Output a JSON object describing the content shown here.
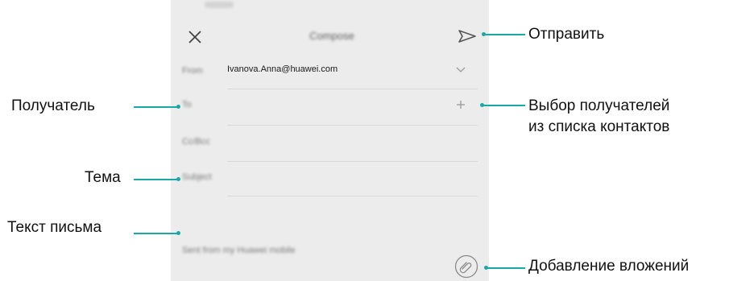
{
  "email": {
    "title": "Compose",
    "from_label": "From",
    "from_value": "Ivanova.Anna@huawei.com",
    "to_label": "To",
    "cc_bcc_label": "Cc/Bcc",
    "subject_label": "Subject",
    "body_placeholder": "Sent from my Huawei mobile"
  },
  "callouts": {
    "send": "Отправить",
    "recipient": "Получатель",
    "contacts_line1": "Выбор получателей",
    "contacts_line2": "из списка контактов",
    "subject": "Тема",
    "body": "Текст письма",
    "attach": "Добавление вложений"
  },
  "icons": {
    "close": "close-icon",
    "send": "send-icon",
    "expand": "chevron-down-icon",
    "add": "plus-icon",
    "attach": "paperclip-icon"
  },
  "colors": {
    "accent": "#1aa7a7",
    "panel": "#ececec",
    "text": "#111111"
  }
}
